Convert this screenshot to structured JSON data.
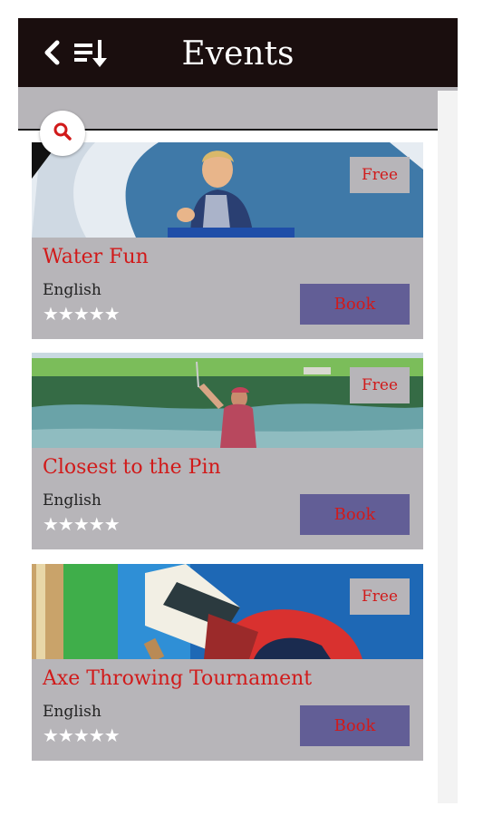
{
  "header": {
    "title": "Events",
    "back_icon": "chevron-left-icon",
    "sort_icon": "sort-list-icon"
  },
  "search": {
    "icon": "search-icon"
  },
  "colors": {
    "appbar": "#1a0e0e",
    "card_bg": "#b7b5b9",
    "accent_red": "#d11a1a",
    "book_button": "#625e96"
  },
  "events": [
    {
      "title": "Water Fun",
      "language": "English",
      "price": "Free",
      "rating": "★★★★★",
      "book_label": "Book",
      "image": "person-on-water-slide"
    },
    {
      "title": "Closest to the Pin",
      "language": "English",
      "price": "Free",
      "rating": "★★★★★",
      "book_label": "Book",
      "image": "golfer-by-lake"
    },
    {
      "title": "Axe Throwing Tournament",
      "language": "English",
      "price": "Free",
      "rating": "★★★★★",
      "book_label": "Book",
      "image": "axe-in-target"
    }
  ]
}
